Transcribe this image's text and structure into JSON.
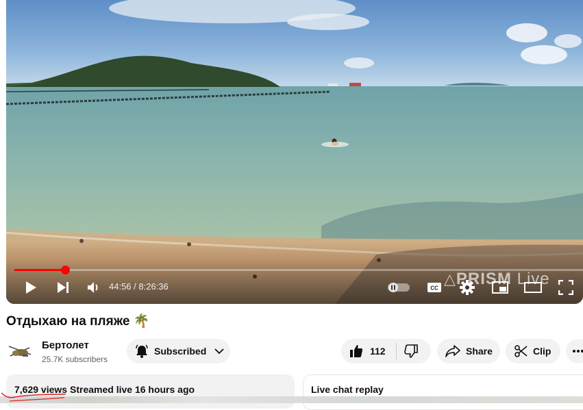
{
  "player": {
    "current_time": "44:56",
    "duration": "8:26:36",
    "time_display": "44:56 / 8:26:36",
    "progress_fraction": 0.089,
    "watermark": "PRISM",
    "watermark_suffix": "Live",
    "colors": {
      "progress": "#ff0000"
    }
  },
  "video": {
    "title": "Отдыхаю на пляже 🌴"
  },
  "channel": {
    "name": "Бертолет",
    "subscribers": "25.7K subscribers",
    "subscribed_label": "Subscribed"
  },
  "actions": {
    "like_count": "112",
    "share_label": "Share",
    "clip_label": "Clip"
  },
  "description": {
    "views": "7,629 views",
    "streamed": "Streamed live 16 hours ago"
  },
  "chat": {
    "label": "Live chat replay"
  },
  "icons": [
    "play-icon",
    "next-icon",
    "volume-icon",
    "autoplay-toggle-icon",
    "captions-icon",
    "settings-icon",
    "miniplayer-icon",
    "theater-icon",
    "fullscreen-icon",
    "bell-icon",
    "chevron-down-icon",
    "thumbs-up-icon",
    "thumbs-down-icon",
    "share-icon",
    "scissors-icon",
    "more-icon"
  ]
}
